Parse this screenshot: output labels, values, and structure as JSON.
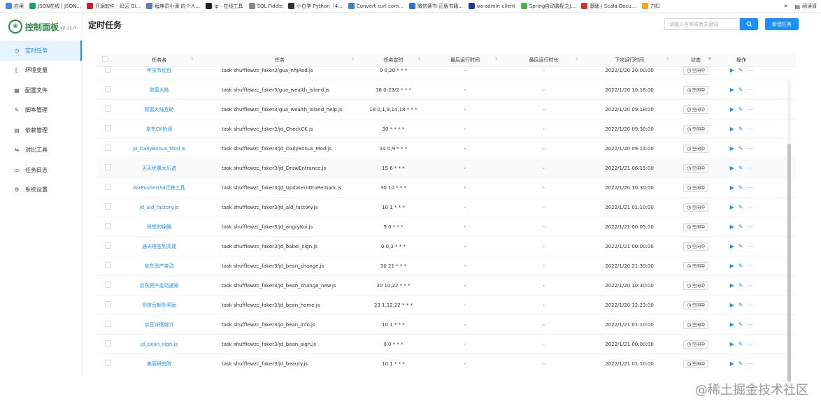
{
  "bookmarks": [
    {
      "label": "应用",
      "color": "#4285f4"
    },
    {
      "label": "JSON在线 | JSON...",
      "color": "#1aa260"
    },
    {
      "label": "开源软件 - 码云 Gi...",
      "color": "#c71d23"
    },
    {
      "label": "程序员小濠 的个人...",
      "color": "#5a7fb0"
    },
    {
      "label": "ip - 在线工具",
      "color": "#222222"
    },
    {
      "label": "SQL Fiddle",
      "color": "#888888"
    },
    {
      "label": "小白学 Python（4...",
      "color": "#333333"
    },
    {
      "label": "Convert curl com...",
      "color": "#3b82c4"
    },
    {
      "label": "微信读书-正版书籍...",
      "color": "#2a6fdb"
    },
    {
      "label": "oa-admin-client",
      "color": "#1f3a93"
    },
    {
      "label": "Spring自动装配之J...",
      "color": "#4caf50"
    },
    {
      "label": "基础 | Scala Docu...",
      "color": "#d32f2f"
    },
    {
      "label": "力扣",
      "color": "#f5a623"
    }
  ],
  "bookmarks_more": "»",
  "reading_list": "阅读清",
  "sidebar": {
    "logo_text": "控制面板",
    "version": "v2.11.0",
    "items": [
      {
        "label": "定时任务",
        "icon": "clock-icon",
        "glyph": "◷",
        "active": true
      },
      {
        "label": "环境变量",
        "icon": "variable-icon",
        "glyph": "⟦",
        "active": false
      },
      {
        "label": "配置文件",
        "icon": "config-icon",
        "glyph": "▦",
        "active": false
      },
      {
        "label": "脚本管理",
        "icon": "script-icon",
        "glyph": "✎",
        "active": false
      },
      {
        "label": "依赖管理",
        "icon": "dependency-icon",
        "glyph": "▤",
        "active": false
      },
      {
        "label": "对比工具",
        "icon": "diff-icon",
        "glyph": "⇋",
        "active": false
      },
      {
        "label": "任务日志",
        "icon": "folder-icon",
        "glyph": "▭",
        "active": false
      },
      {
        "label": "系统设置",
        "icon": "settings-icon",
        "glyph": "⚙",
        "active": false
      }
    ]
  },
  "header": {
    "title": "定时任务",
    "search_placeholder": "请输入名称或者关键词",
    "new_button": "新建任务"
  },
  "table": {
    "columns": [
      "任务名",
      "任务",
      "任务定时",
      "最后运行时间",
      "最后运行时长",
      "下次运行时间",
      "状态",
      "操作"
    ],
    "status_label": "空闲中",
    "rows": [
      {
        "name": "年货节红包",
        "command": "task shufflewzc_faker3/gua_nhjRed.js",
        "cron": "0 0,20 * * *",
        "last": "-",
        "duration": "-",
        "next": "2022/1/20 20:00:00"
      },
      {
        "name": "财富大陆",
        "command": "task shufflewzc_faker3/gua_wealth_island.js",
        "cron": "18 0-23/2 * * *",
        "last": "-",
        "duration": "-",
        "next": "2022/1/20 10:18:00"
      },
      {
        "name": "财富大陆互助",
        "command": "task shufflewzc_faker3/gua_wealth_island_help.js",
        "cron": "18 0,1,9,14,18 * * *",
        "last": "-",
        "duration": "-",
        "next": "2022/1/20 09:18:00"
      },
      {
        "name": "京东CK检测",
        "command": "task shufflewzc_faker3/jd_CheckCK.js",
        "cron": "30 * * * *",
        "last": "-",
        "duration": "-",
        "next": "2022/1/20 09:30:00"
      },
      {
        "name": "jd_DailyBonus_Mod.js",
        "command": "task shufflewzc_faker3/jd_DailyBonus_Mod.js",
        "cron": "14 0,9 * * *",
        "last": "-",
        "duration": "-",
        "next": "2022/1/20 09:14:00"
      },
      {
        "name": "天天优惠大乐透",
        "command": "task shufflewzc_faker3/jd_DrawEntrance.js",
        "cron": "15 6 * * *",
        "last": "-",
        "duration": "-",
        "next": "2022/1/21 06:15:00"
      },
      {
        "name": "WxPusherUid迁移工具",
        "command": "task shufflewzc_faker3/jd_UpdateUIDtoRemark.js",
        "cron": "30 10 * * *",
        "last": "-",
        "duration": "-",
        "next": "2022/1/20 10:30:00"
      },
      {
        "name": "jd_aid_factory.js",
        "command": "task shufflewzc_faker3/jd_aid_factory.js",
        "cron": "10 1 * * *",
        "last": "-",
        "duration": "-",
        "next": "2022/1/21 01:10:00"
      },
      {
        "name": "愤怒的锦鲤",
        "command": "task shufflewzc_faker3/jd_angryKoi.js",
        "cron": "5 0 * * *",
        "last": "-",
        "duration": "-",
        "next": "2022/1/21 00:05:00"
      },
      {
        "name": "通天塔签到共建",
        "command": "task shufflewzc_faker3/jd_babel_sign.js",
        "cron": "0 0,3 * * *",
        "last": "-",
        "duration": "-",
        "next": "2022/1/21 00:00:00"
      },
      {
        "name": "京东资产变动",
        "command": "task shufflewzc_faker3/jd_bean_change.js",
        "cron": "30 21 * * *",
        "last": "-",
        "duration": "-",
        "next": "2022/1/20 21:30:00"
      },
      {
        "name": "京东资产变动通知",
        "command": "task shufflewzc_faker3/jd_bean_change_new.js",
        "cron": "30 10,22 * * *",
        "last": "-",
        "duration": "-",
        "next": "2022/1/20 10:30:00"
      },
      {
        "name": "领京豆额外奖励",
        "command": "task shufflewzc_faker3/jd_bean_home.js",
        "cron": "23 1,12,22 * * *",
        "last": "-",
        "duration": "-",
        "next": "2022/1/20 12:23:00"
      },
      {
        "name": "京豆详情统计",
        "command": "task shufflewzc_faker3/jd_bean_info.js",
        "cron": "10 1 * * *",
        "last": "-",
        "duration": "-",
        "next": "2022/1/21 01:10:00"
      },
      {
        "name": "jd_bean_sign.js",
        "command": "task shufflewzc_faker3/jd_bean_sign.js",
        "cron": "0 0 * * *",
        "last": "-",
        "duration": "-",
        "next": "2022/1/21 00:00:00"
      },
      {
        "name": "美丽研究院",
        "command": "task shufflewzc_faker3/jd_beauty.js",
        "cron": "10 1 * * *",
        "last": "-",
        "duration": "-",
        "next": "2022/1/21 01:10:00"
      }
    ]
  },
  "watermark": "@稀土掘金技术社区"
}
